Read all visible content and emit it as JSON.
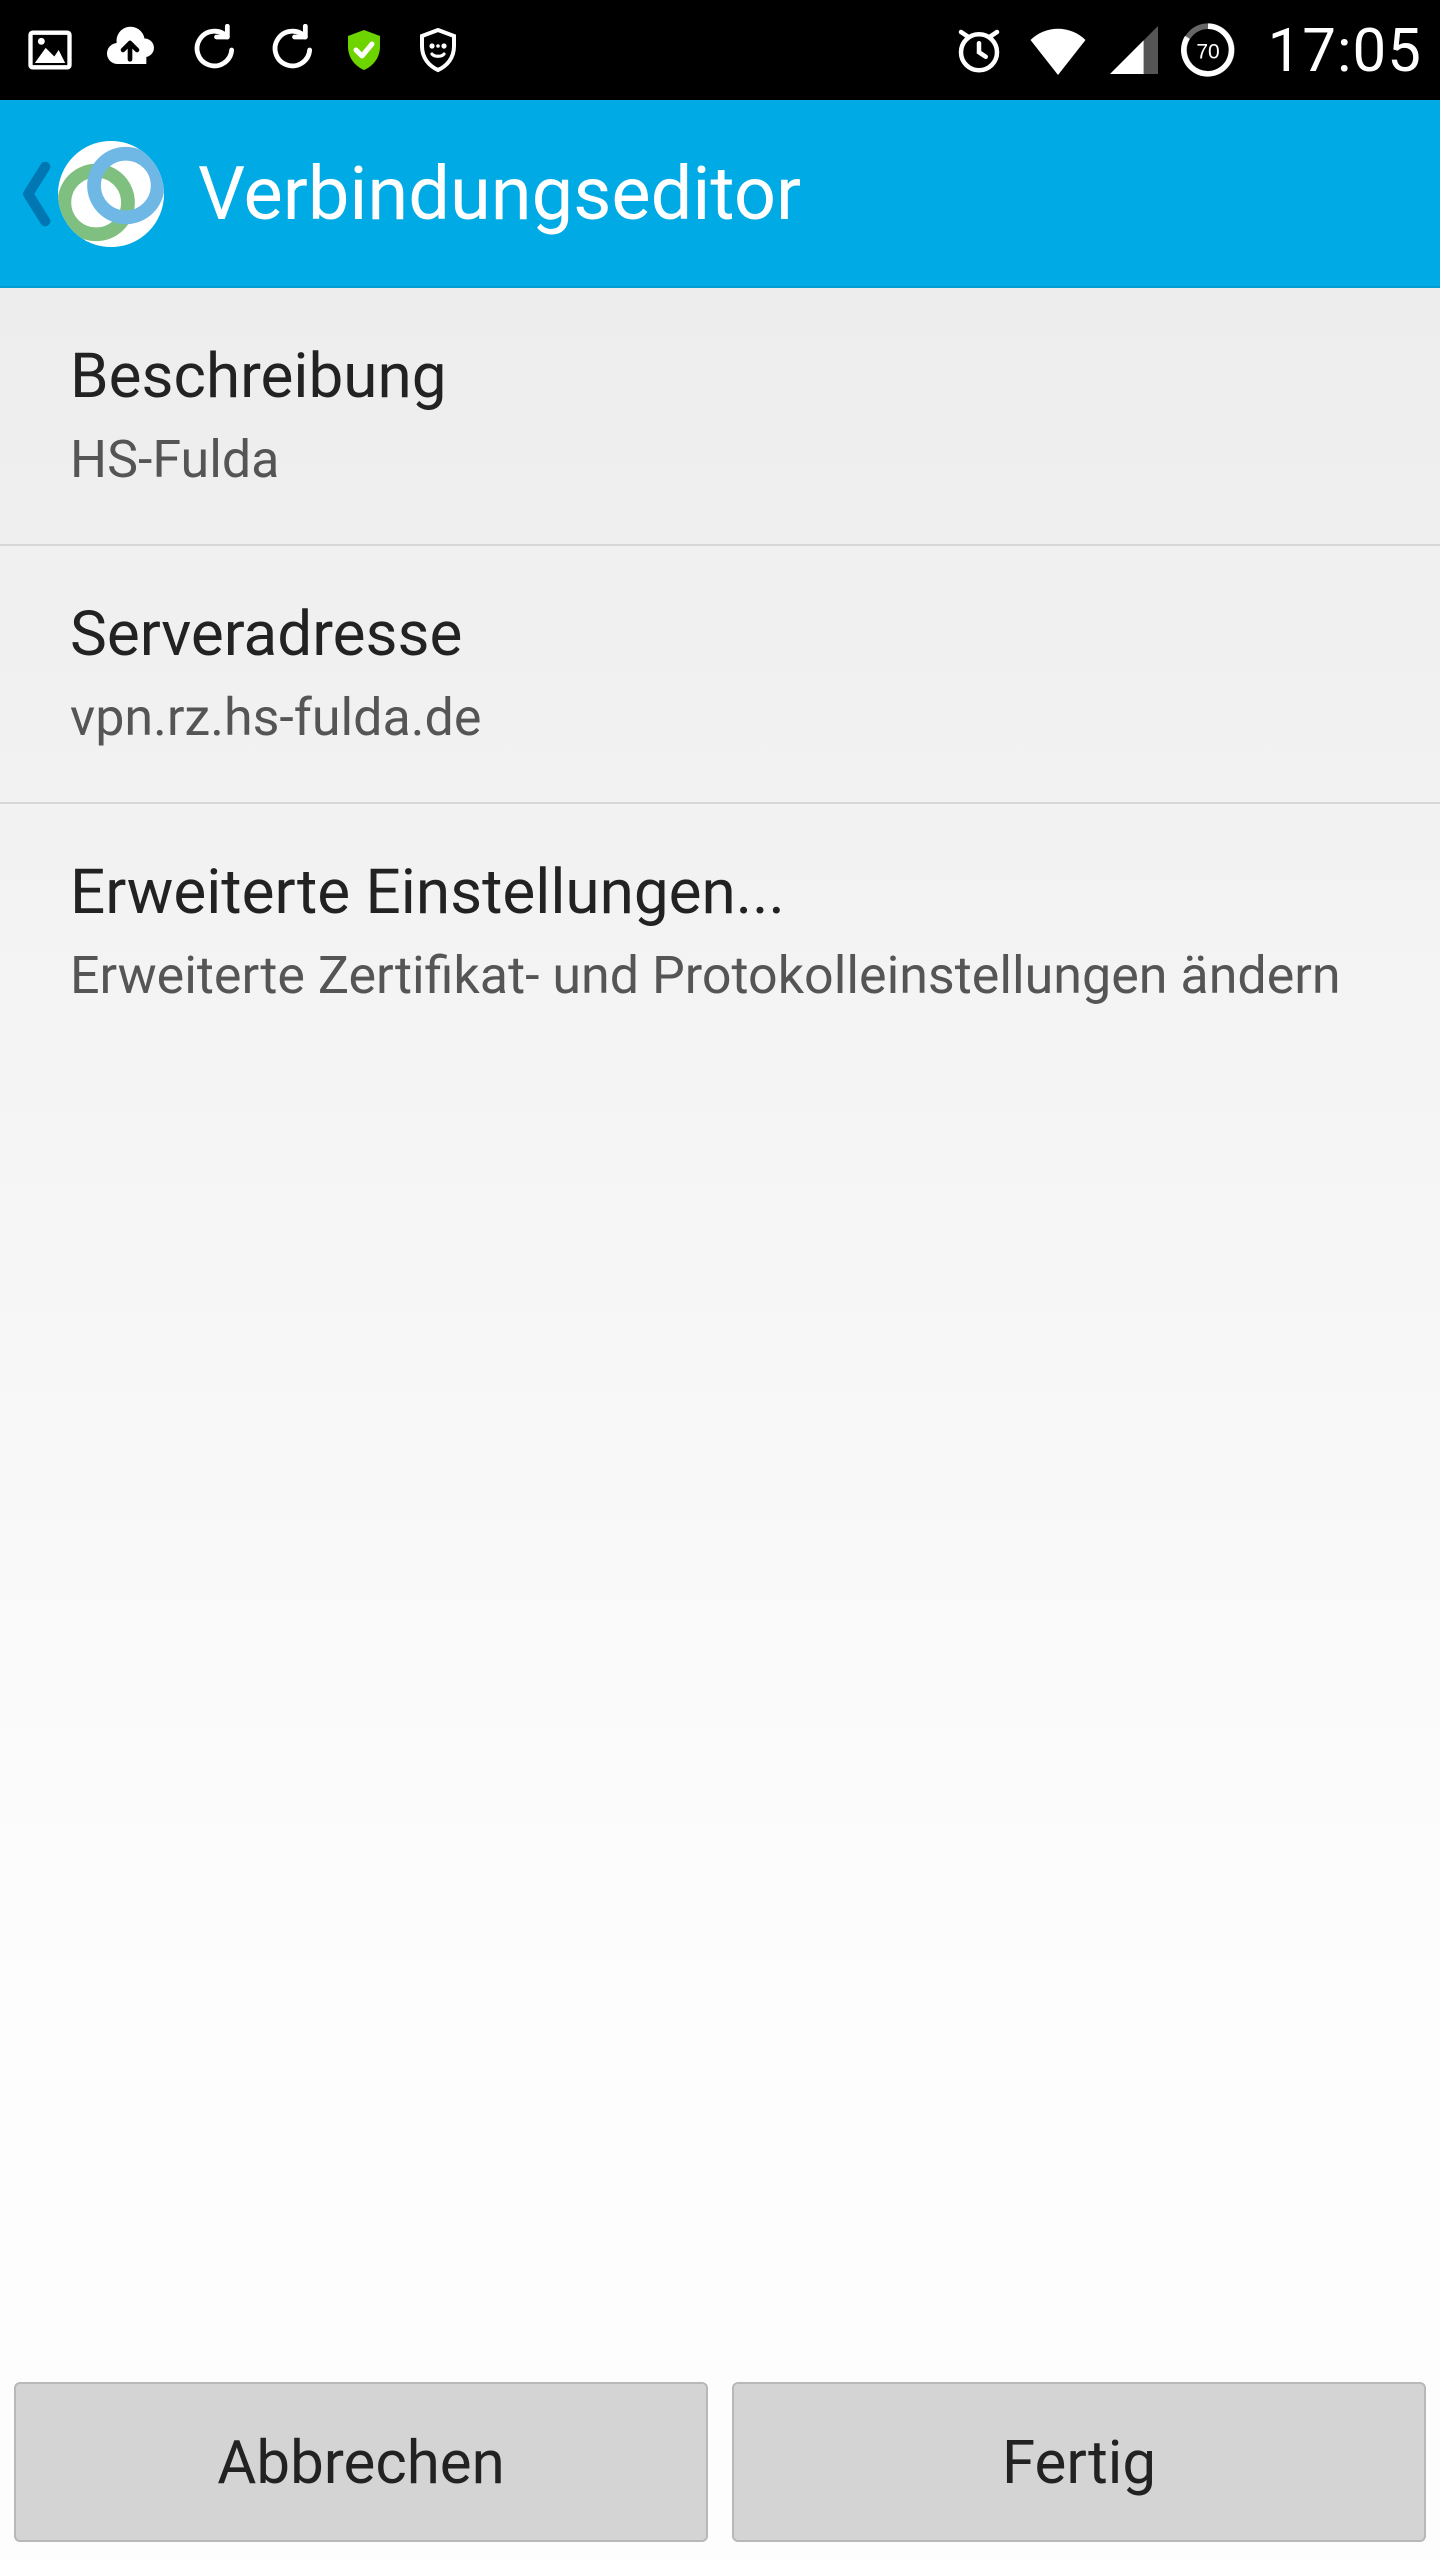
{
  "status": {
    "time": "17:05",
    "battery_percent": "70"
  },
  "header": {
    "title": "Verbindungseditor"
  },
  "items": [
    {
      "title": "Beschreibung",
      "subtitle": "HS-Fulda"
    },
    {
      "title": "Serveradresse",
      "subtitle": "vpn.rz.hs-fulda.de"
    },
    {
      "title": "Erweiterte Einstellungen...",
      "subtitle": "Erweiterte Zertifikat- und Protokolleinstellungen ändern"
    }
  ],
  "buttons": {
    "cancel": "Abbrechen",
    "done": "Fertig"
  }
}
